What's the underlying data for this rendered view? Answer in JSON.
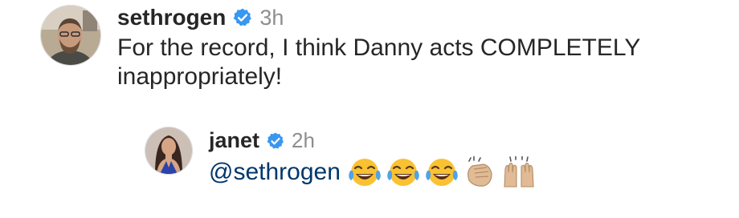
{
  "comment": {
    "username": "sethrogen",
    "time": "3h",
    "text": "For the record, I think Danny acts COMPLETELY inappropriately!"
  },
  "reply": {
    "username": "janet",
    "time": "2h",
    "mention": "@sethrogen",
    "emojis": [
      "face-with-tears-of-joy",
      "face-with-tears-of-joy",
      "face-with-tears-of-joy",
      "clapping-hands",
      "raising-hands"
    ]
  },
  "colors": {
    "text": "#262626",
    "muted": "#8e8e8e",
    "mention": "#00376b",
    "verified": "#3897f0"
  }
}
